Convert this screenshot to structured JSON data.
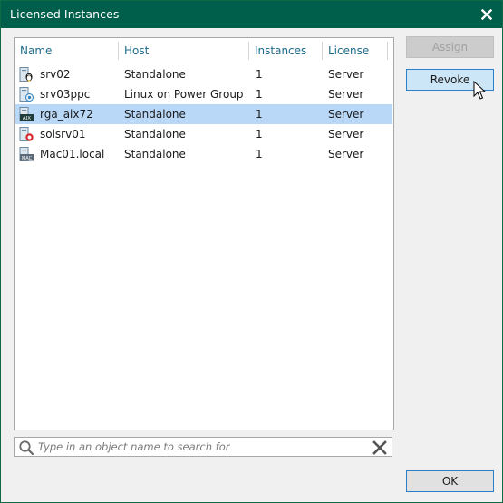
{
  "window": {
    "title": "Licensed Instances"
  },
  "table": {
    "columns": [
      "Name",
      "Host",
      "Instances",
      "License"
    ],
    "rows": [
      {
        "icon": "linux-server-icon",
        "name": "srv02",
        "host": "Standalone",
        "instances": "1",
        "license": "Server"
      },
      {
        "icon": "power-group-server-icon",
        "name": "srv03ppc",
        "host": "Linux on Power Group",
        "instances": "1",
        "license": "Server"
      },
      {
        "icon": "aix-server-icon",
        "name": "rga_aix72",
        "host": "Standalone",
        "instances": "1",
        "license": "Server",
        "selected": true
      },
      {
        "icon": "solaris-server-icon",
        "name": "solsrv01",
        "host": "Standalone",
        "instances": "1",
        "license": "Server"
      },
      {
        "icon": "mac-server-icon",
        "name": "Mac01.local",
        "host": "Standalone",
        "instances": "1",
        "license": "Server"
      }
    ]
  },
  "buttons": {
    "assign": "Assign",
    "revoke": "Revoke",
    "ok": "OK"
  },
  "search": {
    "placeholder": "Type in an object name to search for",
    "value": ""
  },
  "icons": {
    "aix_label": "AIX",
    "mac_label": "MAC"
  },
  "colors": {
    "titlebar": "#005f4b",
    "selection": "#b9d8f7",
    "header_text": "#1d6a8a"
  }
}
